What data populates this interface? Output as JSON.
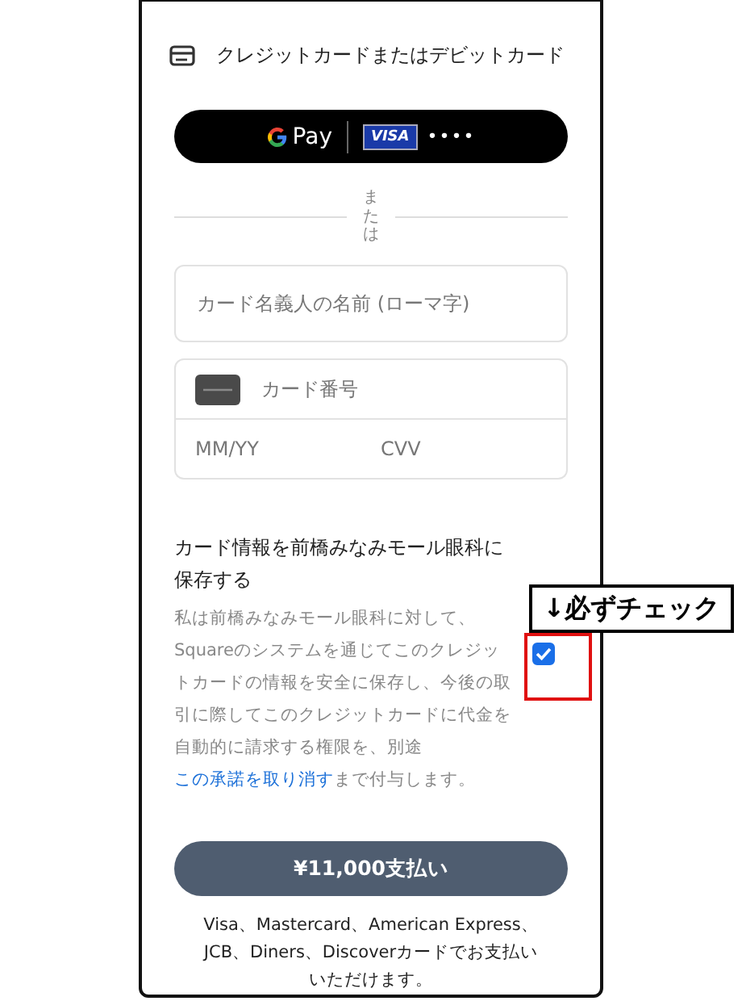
{
  "header": {
    "title": "クレジットカードまたはデビットカード"
  },
  "wallet_button": {
    "pay_label": "Pay",
    "card_brand": "VISA",
    "card_digits": "••••"
  },
  "divider_text": "または",
  "name_field": {
    "placeholder": "カード名義人の名前 (ローマ字)"
  },
  "card_number_field": {
    "placeholder": "カード番号"
  },
  "expiry_field": {
    "placeholder": "MM/YY"
  },
  "cvv_field": {
    "placeholder": "CVV"
  },
  "save_card": {
    "title": "カード情報を前橋みなみモール眼科に保存する",
    "text_before": "私は前橋みなみモール眼科に対して、Squareのシステムを通じてこのクレジットカードの情報を安全に保存し、今後の取引に際してこのクレジットカードに代金を自動的に請求する権限を、別途",
    "link": "この承諾を取り消す",
    "text_after": "まで付与します。",
    "checked": true
  },
  "pay_button": {
    "label": "¥11,000支払い"
  },
  "footer_note": "Visa、Mastercard、American Express、JCB、Diners、Discoverカードでお支払いいただけます。",
  "annotation": {
    "label": "↓必ずチェック"
  }
}
